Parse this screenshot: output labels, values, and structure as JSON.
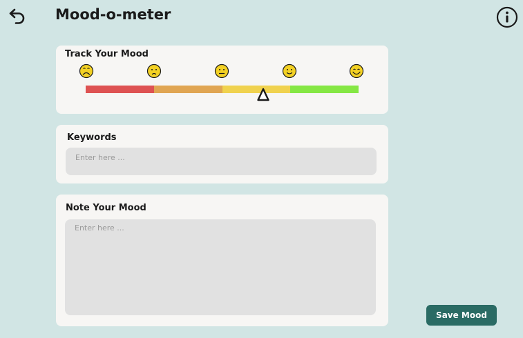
{
  "header": {
    "title": "Mood-o-meter",
    "back_icon": "back-arrow-icon",
    "info_icon": "info-icon"
  },
  "track": {
    "label": "Track Your Mood",
    "faces": [
      {
        "name": "very-sad-face-icon",
        "mood": "very-sad"
      },
      {
        "name": "sad-face-icon",
        "mood": "sad"
      },
      {
        "name": "neutral-face-icon",
        "mood": "neutral"
      },
      {
        "name": "slight-smile-face-icon",
        "mood": "happy"
      },
      {
        "name": "big-smile-face-icon",
        "mood": "very-happy"
      }
    ],
    "scale_colors": [
      "#de5252",
      "#e0a552",
      "#f0d24e",
      "#85e744"
    ],
    "face_color": "#f3d124",
    "selected_value": 0.65
  },
  "keywords": {
    "label": "Keywords",
    "placeholder": "Enter here ..."
  },
  "note": {
    "label": "Note Your Mood",
    "placeholder": "Enter here ..."
  },
  "save_label": "Save Mood",
  "colors": {
    "background": "#d1e5e4",
    "card": "#f7f6f4",
    "input": "#e1e1e1",
    "accent": "#2a6b64"
  }
}
